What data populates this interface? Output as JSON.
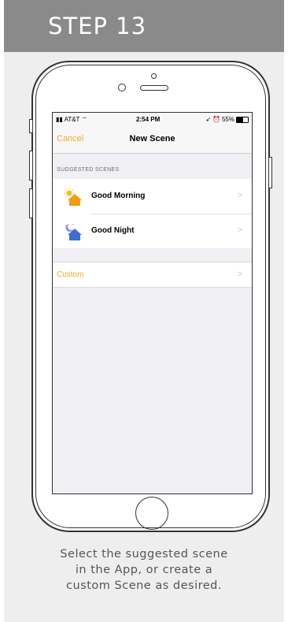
{
  "step": {
    "title": "STEP 13"
  },
  "status_bar": {
    "carrier": "AT&T",
    "time": "2:54 PM",
    "battery": "55%"
  },
  "nav": {
    "cancel_label": "Cancel",
    "title": "New Scene"
  },
  "suggested": {
    "header": "SUGGESTED SCENES",
    "items": [
      {
        "label": "Good Morning",
        "icon": "sun-house-icon"
      },
      {
        "label": "Good Night",
        "icon": "moon-house-icon"
      }
    ]
  },
  "custom": {
    "label": "Custom"
  },
  "caption": {
    "lines": [
      "Select the suggested scene",
      "in the App, or create a",
      "custom Scene as desired."
    ]
  },
  "colors": {
    "accent": "#f5a623",
    "header_bg": "#8a8a8a",
    "card_bg": "#eeeeee"
  }
}
